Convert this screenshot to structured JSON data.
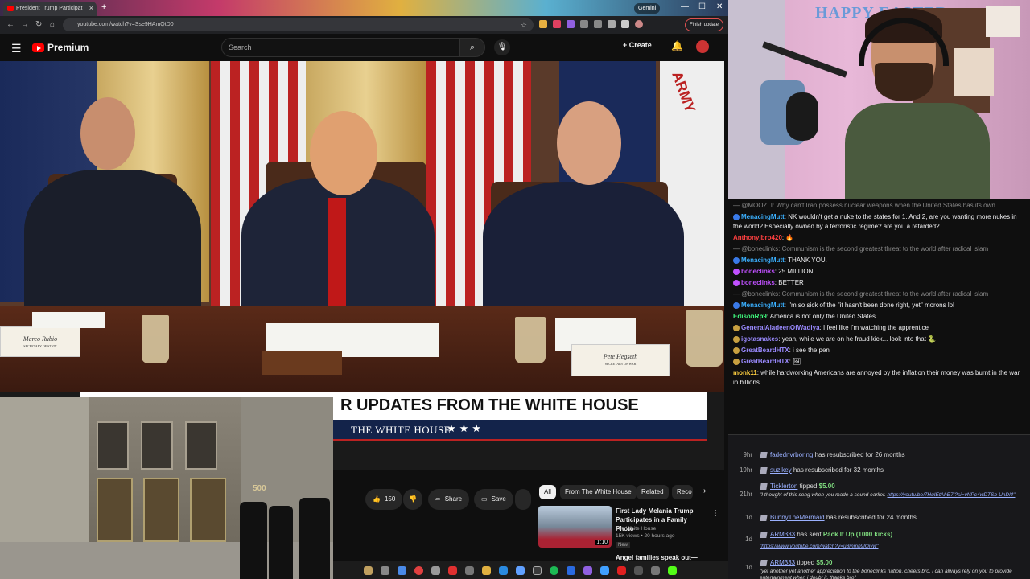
{
  "browser": {
    "tab_title": "President Trump Participat",
    "new_tab": "+",
    "gemini": "Gemini",
    "url": "youtube.com/watch?v=Sse9HAmQtD0",
    "finish_update": "Finish update",
    "minimize": "—",
    "maximize": "☐",
    "close": "✕"
  },
  "youtube": {
    "brand": "Premium",
    "search_placeholder": "Search",
    "create": "Create"
  },
  "video": {
    "nameplate_left": "Marco Rubio",
    "nameplate_left_sub": "SECRETARY OF STATE",
    "nameplate_right": "Pete Hegseth",
    "nameplate_right_sub": "SECRETARY OF WAR",
    "army_flag_text": "ARMY"
  },
  "banner": {
    "headline": "R UPDATES FROM THE WHITE HOUSE",
    "sub": "THE WHITE HOUSE",
    "stars": "★★★"
  },
  "building_number": "500",
  "actions": {
    "likes": "150",
    "share": "Share",
    "save": "Save"
  },
  "chips": [
    "All",
    "From The White House",
    "Related",
    "Reco"
  ],
  "recommendation": {
    "title": "First Lady Melania Trump Participates in a Family Photo",
    "channel": "The White House",
    "meta": "15K views • 20 hours ago",
    "badge": "New",
    "duration": "1:10",
    "next_title": "Angel families speak out—"
  },
  "chat": [
    {
      "type": "reply",
      "text": "— @MOOZLI: Why can't Iran possess nuclear weapons when the United States has its own"
    },
    {
      "type": "msg",
      "user": "MenacingMutt",
      "color": "#3ab0ff",
      "text": "NK wouldn't get a nuke to the states for 1. And 2, are you wanting more nukes in the world? Especially owned by a terroristic regime? are you a retarded?"
    },
    {
      "type": "msg",
      "user": "Anthonyjbro420",
      "color": "#ff4040",
      "text": "🔥"
    },
    {
      "type": "reply",
      "text": "— @boneclinks: Communism is the second greatest threat to the world after radical islam"
    },
    {
      "type": "msg",
      "user": "MenacingMutt",
      "color": "#3ab0ff",
      "text": "THANK YOU."
    },
    {
      "type": "msg",
      "user": "boneclinks",
      "color": "#c050ff",
      "text": "25 MILLION"
    },
    {
      "type": "msg",
      "user": "boneclinks",
      "color": "#c050ff",
      "text": "BETTER"
    },
    {
      "type": "reply",
      "text": "— @boneclinks: Communism is the second greatest threat to the world after radical islam"
    },
    {
      "type": "msg",
      "user": "MenacingMutt",
      "color": "#3ab0ff",
      "text": "I'm so sick of the \"it hasn't been done right, yet\" morons lol"
    },
    {
      "type": "msg",
      "user": "EdisonRp9",
      "color": "#40ff80",
      "text": "America is not only the United States"
    },
    {
      "type": "msg",
      "user": "GeneralAladeenOfWadiya",
      "color": "#9a8aff",
      "text": "I feel like I'm watching the apprentice"
    },
    {
      "type": "msg",
      "user": "igotasnakes",
      "color": "#9a8aff",
      "text": "yeah, while we are on he fraud kick... look into that 🐍"
    },
    {
      "type": "msg",
      "user": "GreatBeardHTX",
      "color": "#9a8aff",
      "text": "i see the pen"
    },
    {
      "type": "msg",
      "user": "GreatBeardHTX",
      "color": "#9a8aff",
      "text": "🖼"
    },
    {
      "type": "msg",
      "user": "monk11",
      "color": "#ffd040",
      "text": "while hardworking Americans are annoyed by the inflation their money was burnt in the war in billions"
    }
  ],
  "events": [
    {
      "time": "9hr",
      "user": "fadednvrboring",
      "text": "has resubscribed for 26 months"
    },
    {
      "time": "19hr",
      "user": "suzikey",
      "text": "has resubscribed for 32 months"
    },
    {
      "time": "21hr",
      "user": "Ticklerton",
      "text": "tipped",
      "amount": "$5.00",
      "message": "\"I thought of this song when you made a sound earlier.",
      "link": "https://youtu.be/7HqIEtAhE7I?si=vNPc4wDTSb-UnDl4\""
    },
    {
      "time": "1d",
      "user": "BunnyTheMermaid",
      "text": "has resubscribed for 24 months"
    },
    {
      "time": "1d",
      "user": "ARM333",
      "text": "has sent",
      "amount": "Pack It Up (1000 kicks)",
      "message": "",
      "link": "\"https://www.youtube.com/watch?v=u8mmn9lOiyw\""
    },
    {
      "time": "1d",
      "user": "ARM333",
      "text": "tipped",
      "amount": "$5.00",
      "message": "\"yet another yet another appreciation to the boneclinks nation, cheers bro, i can always rely on you to provide entertainment when i doubt it, thanks bro\"",
      "link": ""
    }
  ],
  "webcam_text": "HAPPY EASTER"
}
